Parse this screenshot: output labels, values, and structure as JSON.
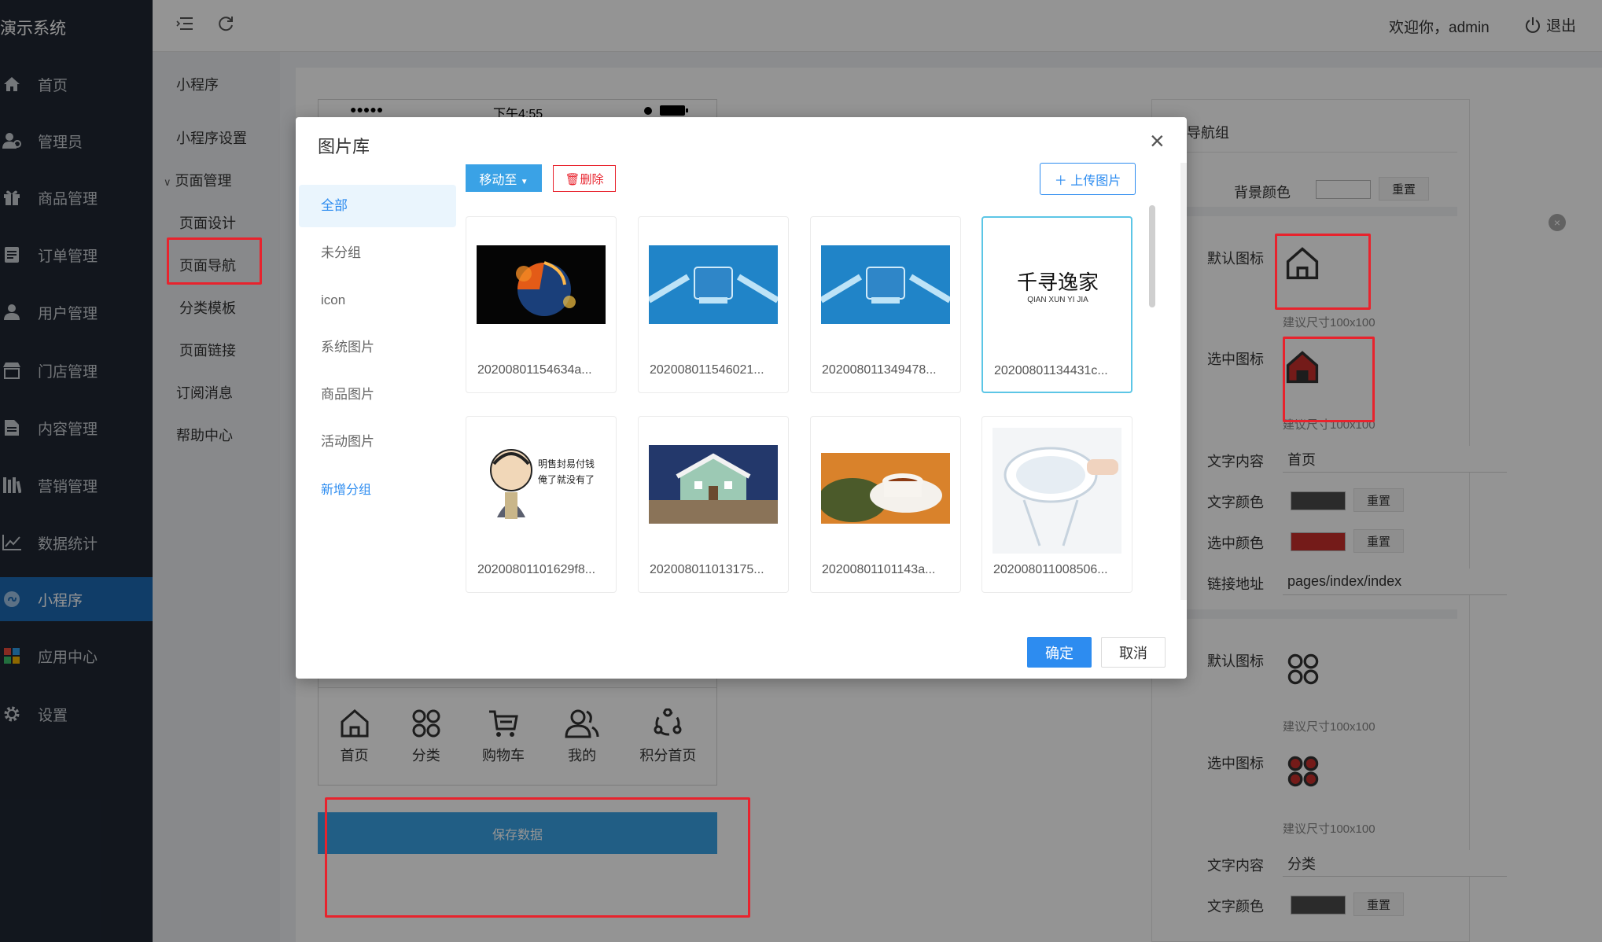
{
  "app": {
    "title": "演示系统"
  },
  "sidebar": {
    "items": [
      {
        "label": "首页",
        "icon": "home-icon"
      },
      {
        "label": "管理员",
        "icon": "admin-icon"
      },
      {
        "label": "商品管理",
        "icon": "gift-icon"
      },
      {
        "label": "订单管理",
        "icon": "order-icon"
      },
      {
        "label": "用户管理",
        "icon": "user-icon"
      },
      {
        "label": "门店管理",
        "icon": "store-icon"
      },
      {
        "label": "内容管理",
        "icon": "document-icon"
      },
      {
        "label": "营销管理",
        "icon": "marketing-icon"
      },
      {
        "label": "数据统计",
        "icon": "chart-icon"
      },
      {
        "label": "小程序",
        "icon": "miniprogram-icon"
      },
      {
        "label": "应用中心",
        "icon": "apps-icon"
      },
      {
        "label": "设置",
        "icon": "gear-icon"
      }
    ],
    "active_label": "小程序"
  },
  "subnav": {
    "items": [
      "小程序",
      "小程序设置",
      "页面管理",
      "页面设计",
      "页面导航",
      "分类模板",
      "页面链接",
      "订阅消息",
      "帮助中心"
    ]
  },
  "header": {
    "welcome": "欢迎你，admin",
    "logout": "退出"
  },
  "phone": {
    "status_carrier": "●●●●●",
    "status_time": "下午4:55",
    "tabs": [
      "首页",
      "分类",
      "购物车",
      "我的",
      "积分首页"
    ],
    "save_label": "保存数据"
  },
  "settings": {
    "group_title": "导航组",
    "bg_color_label": "背景颜色",
    "reset": "重置",
    "default_icon_label": "默认图标",
    "selected_icon_label": "选中图标",
    "size_hint": "建议尺寸100x100",
    "text_content_label": "文字内容",
    "text_color_label": "文字颜色",
    "selected_color_label": "选中颜色",
    "link_label": "链接地址",
    "item1": {
      "text": "首页",
      "link": "pages/index/index",
      "text_color": "#4a4a4a",
      "selected_color": "#c8302c"
    },
    "item2": {
      "text": "分类",
      "text_color": "#4a4a4a"
    },
    "bg_color": "#ffffff"
  },
  "modal": {
    "title": "图片库",
    "groups": [
      "全部",
      "未分组",
      "icon",
      "系统图片",
      "商品图片",
      "活动图片"
    ],
    "add_group": "新增分组",
    "move_label": "移动至",
    "delete_label": "删除",
    "upload_label": "上传图片",
    "confirm": "确定",
    "cancel": "取消",
    "images": [
      {
        "name": "20200801154634a..."
      },
      {
        "name": "202008011546021..."
      },
      {
        "name": "202008011349478..."
      },
      {
        "name": "20200801134431c...",
        "selected": true,
        "logo_text": "千寻逸家",
        "logo_sub": "QIAN XUN YI JIA"
      },
      {
        "name": "20200801101629f8...",
        "meme_text": "明售封易付钱 俺了就没有了"
      },
      {
        "name": "202008011013175..."
      },
      {
        "name": "20200801101143a..."
      },
      {
        "name": "202008011008506..."
      }
    ]
  }
}
